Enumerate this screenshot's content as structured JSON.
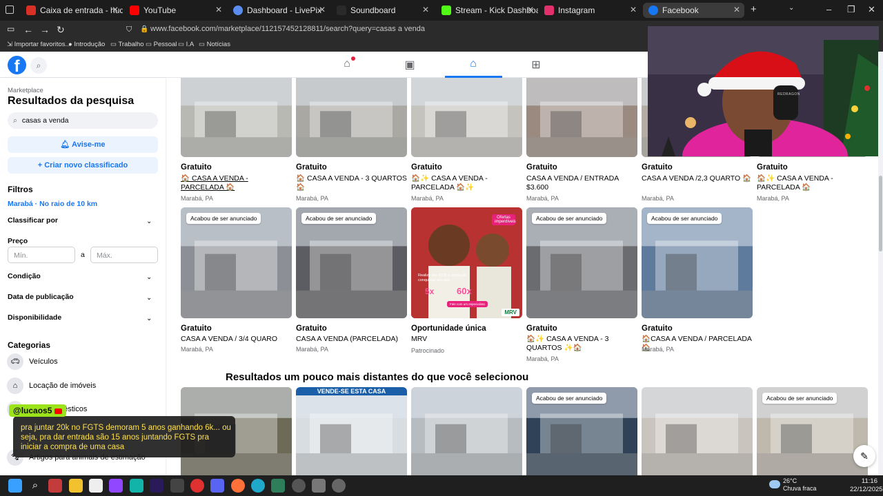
{
  "browser": {
    "tabs": [
      {
        "label": "Caixa de entrada - hudsonfabio",
        "color": "#d93025"
      },
      {
        "label": "YouTube",
        "color": "#ff0000"
      },
      {
        "label": "Dashboard - LivePix",
        "color": "#5b8def"
      },
      {
        "label": "Soundboard",
        "color": "#2a2a2a"
      },
      {
        "label": "Stream - Kick Dashboard",
        "color": "#53fc18"
      },
      {
        "label": "Instagram",
        "color": "#e1306c"
      },
      {
        "label": "Facebook",
        "color": "#1877f2"
      }
    ],
    "url": "www.facebook.com/marketplace/112157452128811/search?query=casas a venda",
    "bookmarks": [
      "Importar favoritos...",
      "Introdução",
      "Trabalho",
      "Pessoal",
      "I.A",
      "Notícias"
    ]
  },
  "sidebar": {
    "breadcrumb": "Marketplace",
    "title": "Resultados da pesquisa",
    "search_value": "casas a venda",
    "notify_label": "Avise-me",
    "create_label": "Criar novo classificado",
    "filters_heading": "Filtros",
    "location": "Marabá · No raio de 10 km",
    "sort_label": "Classificar por",
    "price_label": "Preço",
    "price_min_placeholder": "Mín.",
    "price_sep": "a",
    "price_max_placeholder": "Máx.",
    "condition_label": "Condição",
    "date_label": "Data de publicação",
    "availability_label": "Disponibilidade",
    "categories_heading": "Categorias",
    "categories": [
      "Veículos",
      "Locação de imóveis",
      "Eletrodomésticos",
      "",
      "Artigos para animais de estimação"
    ]
  },
  "listings_row1": [
    {
      "price": "Gratuito",
      "title": "🏠 CASA A VENDA - PARCELADA 🏠",
      "loc": "Marabá, PA",
      "color": "#b9b9b3"
    },
    {
      "price": "Gratuito",
      "title": "🏠 CASA A VENDA - 3 QUARTOS 🏠",
      "loc": "Marabá, PA",
      "color": "#a9a8a3"
    },
    {
      "price": "Gratuito",
      "title": "🏠✨ CASA A VENDA - PARCELADA 🏠✨",
      "loc": "Marabá, PA",
      "color": "#c5c3bd"
    },
    {
      "price": "Gratuito",
      "title": "CASA A VENDA / ENTRADA $3.600",
      "loc": "Marabá, PA",
      "color": "#9a8a80"
    },
    {
      "price": "Gratuito",
      "title": "CASA A VENDA /2,3 QUARTO 🏠",
      "loc": "Marabá, PA",
      "color": "#b3ada5"
    },
    {
      "price": "Gratuito",
      "title": "🏠✨ CASA A VENDA - PARCELADA 🏠",
      "loc": "Marabá, PA",
      "color": "#bdbab5"
    }
  ],
  "listings_row2": [
    {
      "badge": "Acabou de ser anunciado",
      "price": "Gratuito",
      "title": "CASA A VENDA / 3/4 QUARO",
      "loc": "Marabá, PA",
      "color": "#8c9096"
    },
    {
      "badge": "Acabou de ser anunciado",
      "price": "Gratuito",
      "title": "CASA A VENDA (PARCELADA)",
      "loc": "Marabá, PA",
      "color": "#5c5d62"
    },
    {
      "badge": "",
      "price": "Oportunidade única",
      "title": "MRV",
      "loc": "Patrocinado",
      "color": "#c0392b"
    },
    {
      "badge": "Acabou de ser anunciado",
      "price": "Gratuito",
      "title": "🏠✨ CASA A VENDA - 3 QUARTOS ✨🏠",
      "loc": "Marabá, PA",
      "color": "#6a6c70"
    },
    {
      "badge": "Acabou de ser anunciado",
      "price": "Gratuito",
      "title": "🏠CASA A VENDA / PARCELADA 🏠",
      "loc": "Marabá, PA",
      "color": "#5e7a9c"
    }
  ],
  "section_title": "Resultados um pouco mais distantes do que você selecionou",
  "listings_row3": [
    {
      "badge": "",
      "banner": "",
      "color": "#6e6a58"
    },
    {
      "badge": "",
      "banner": "VENDE-SE ESTA CASA",
      "color": "#d8dde2"
    },
    {
      "badge": "",
      "banner": "",
      "color": "#b7bcc1"
    },
    {
      "badge": "Acabou de ser anunciado",
      "banner": "",
      "color": "#2f4258"
    },
    {
      "badge": "",
      "banner": "",
      "color": "#c9c4bd"
    },
    {
      "badge": "Acabou de ser anunciado",
      "banner": "",
      "color": "#bfb8ac"
    }
  ],
  "mrv_promo": {
    "tag": "Ofertas imperdíveis",
    "line1": "Realize em 2026 o sonho de conquistar seu apê.",
    "mult1": "5x",
    "mult2": "60x",
    "cta": "Fale com um especialista",
    "brand": "MRV"
  },
  "chat": {
    "user": "@lucaos5",
    "message": "pra juntar 20k no FGTS demoram 5 anos ganhando 6k... ou seja, pra dar entrada são 15 anos juntando FGTS pra iniciar a compra de uma casa"
  },
  "webcam": {
    "headset_brand": "REDRAGON"
  },
  "taskbar": {
    "temp": "26°C",
    "weather": "Chuva fraca",
    "time": "11:16",
    "date": "22/12/2025"
  }
}
